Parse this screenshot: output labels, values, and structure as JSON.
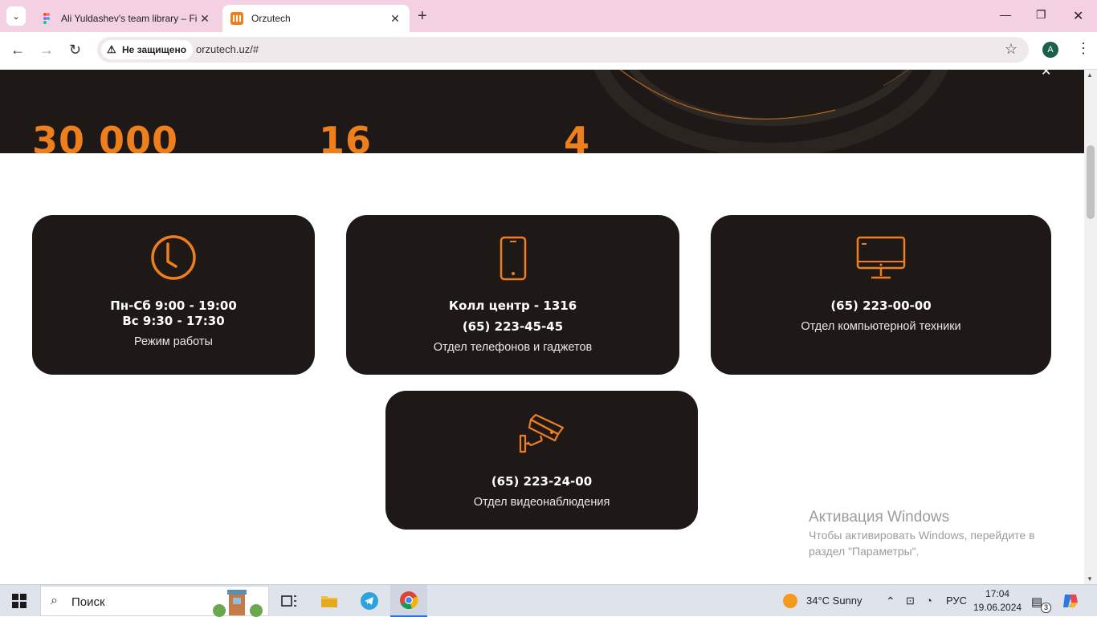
{
  "browser": {
    "tabs": [
      {
        "title": "Ali Yuldashev's team library – Fi",
        "active": false
      },
      {
        "title": "Orzutech",
        "active": true
      }
    ],
    "security_chip": "Не защищено",
    "url": "orzutech.uz/#",
    "profile_initial": "A"
  },
  "hero": {
    "stats": [
      "30 000",
      "16",
      "4"
    ]
  },
  "cards": [
    {
      "line1": "Пн-Сб 9:00 - 19:00",
      "line2": "Вс 9:30 - 17:30",
      "caption": "Режим работы",
      "icon": "clock-icon"
    },
    {
      "line1": "Колл центр - 1316",
      "line2": "(65) 223-45-45",
      "caption": "Отдел телефонов и гаджетов",
      "icon": "smartphone-icon"
    },
    {
      "line1": "(65) 223-00-00",
      "caption": "Отдел компьютерной техники",
      "icon": "monitor-icon"
    },
    {
      "line1": "(65) 223-24-00",
      "caption": "Отдел видеонаблюдения",
      "icon": "cctv-camera-icon"
    }
  ],
  "watermark": {
    "title": "Активация Windows",
    "text": "Чтобы активировать Windows, перейдите в раздел \"Параметры\"."
  },
  "taskbar": {
    "search_label": "Поиск",
    "weather": "34°C  Sunny",
    "language": "РУС",
    "time": "17:04",
    "date": "19.06.2024",
    "notification_count": "3"
  },
  "colors": {
    "accent": "#ee7f1c",
    "card_bg": "#1e1917",
    "tabbar_bg": "#f4d0e3"
  }
}
